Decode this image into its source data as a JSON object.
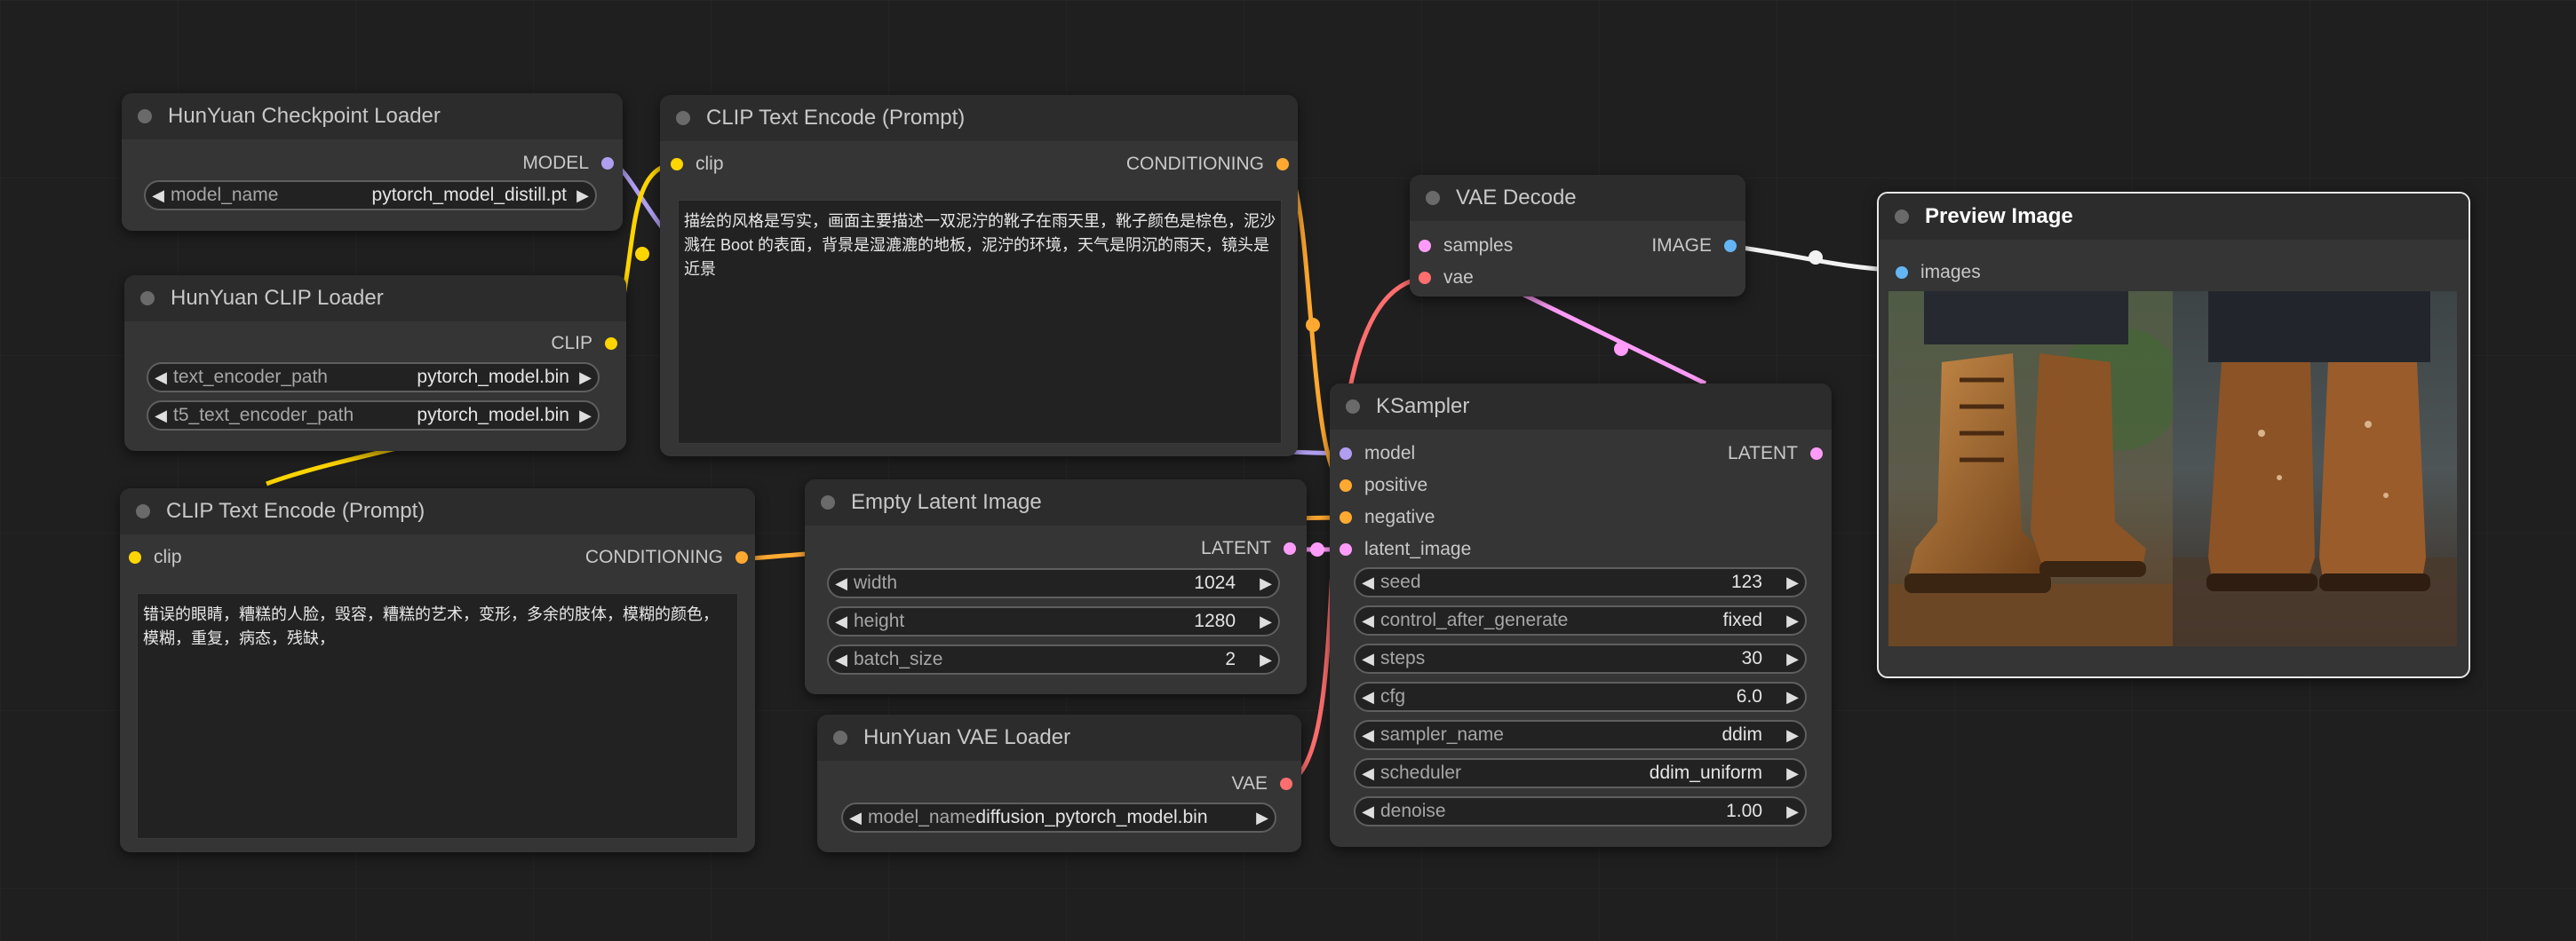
{
  "colors": {
    "model": "#b09ef0",
    "clip": "#ffd500",
    "conditioning": "#ffa931",
    "latent": "#ff9cf9",
    "vae": "#ff6e6e",
    "image": "#64b5f6"
  },
  "nodes": {
    "checkpoint_loader": {
      "title": "HunYuan Checkpoint Loader",
      "out_model": "MODEL",
      "model_name": {
        "label": "model_name",
        "value": "pytorch_model_distill.pt"
      }
    },
    "clip_loader": {
      "title": "HunYuan CLIP Loader",
      "out_clip": "CLIP",
      "text_encoder_path": {
        "label": "text_encoder_path",
        "value": "pytorch_model.bin"
      },
      "t5_text_encoder_path": {
        "label": "t5_text_encoder_path",
        "value": "pytorch_model.bin"
      }
    },
    "clip_text_positive": {
      "title": "CLIP Text Encode (Prompt)",
      "in_clip": "clip",
      "out_conditioning": "CONDITIONING",
      "text": "描绘的风格是写实，画面主要描述一双泥泞的靴子在雨天里，靴子颜色是棕色，泥沙溅在 Boot 的表面，背景是湿漉漉的地板，泥泞的环境，天气是阴沉的雨天，镜头是近景"
    },
    "clip_text_negative": {
      "title": "CLIP Text Encode (Prompt)",
      "in_clip": "clip",
      "out_conditioning": "CONDITIONING",
      "text": "错误的眼睛，糟糕的人脸，毁容，糟糕的艺术，变形，多余的肢体，模糊的颜色，模糊，重复，病态，残缺，"
    },
    "empty_latent": {
      "title": "Empty Latent Image",
      "out_latent": "LATENT",
      "width": {
        "label": "width",
        "value": "1024"
      },
      "height": {
        "label": "height",
        "value": "1280"
      },
      "batch_size": {
        "label": "batch_size",
        "value": "2"
      }
    },
    "vae_loader": {
      "title": "HunYuan VAE Loader",
      "out_vae": "VAE",
      "model_name": {
        "label": "model_name",
        "value": "diffusion_pytorch_model.bin"
      }
    },
    "vae_decode": {
      "title": "VAE Decode",
      "in_samples": "samples",
      "in_vae": "vae",
      "out_image": "IMAGE"
    },
    "ksampler": {
      "title": "KSampler",
      "in_model": "model",
      "in_positive": "positive",
      "in_negative": "negative",
      "in_latent": "latent_image",
      "out_latent": "LATENT",
      "seed": {
        "label": "seed",
        "value": "123"
      },
      "control_after_generate": {
        "label": "control_after_generate",
        "value": "fixed"
      },
      "steps": {
        "label": "steps",
        "value": "30"
      },
      "cfg": {
        "label": "cfg",
        "value": "6.0"
      },
      "sampler_name": {
        "label": "sampler_name",
        "value": "ddim"
      },
      "scheduler": {
        "label": "scheduler",
        "value": "ddim_uniform"
      },
      "denoise": {
        "label": "denoise",
        "value": "1.00"
      }
    },
    "preview": {
      "title": "Preview Image",
      "in_images": "images"
    }
  }
}
